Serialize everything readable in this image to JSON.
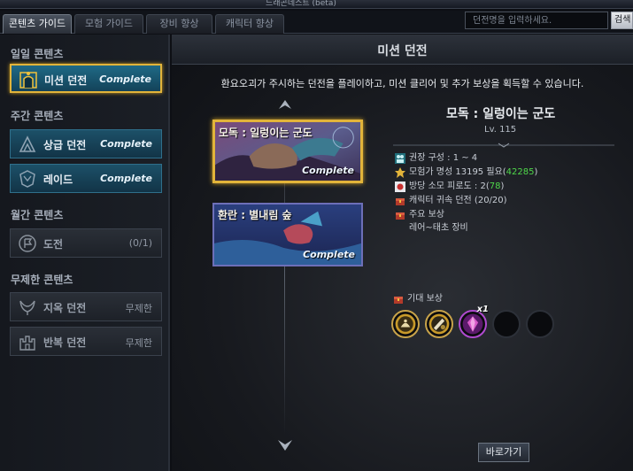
{
  "window": {
    "title": "드래곤네스트 (beta)"
  },
  "tabs": [
    {
      "label": "콘텐츠 가이드",
      "active": true
    },
    {
      "label": "모험 가이드"
    },
    {
      "label": "장비 향상"
    },
    {
      "label": "캐릭터 향상"
    }
  ],
  "search": {
    "placeholder": "던전명을 입력하세요.",
    "button_label": "검색"
  },
  "sidebar": {
    "daily": {
      "heading": "일일 콘텐츠",
      "items": [
        {
          "label": "미션 던전",
          "status": "Complete",
          "icon": "gate-icon"
        }
      ]
    },
    "weekly": {
      "heading": "주간 콘텐츠",
      "items": [
        {
          "label": "상급 던전",
          "status": "Complete",
          "icon": "peak-icon"
        },
        {
          "label": "레이드",
          "status": "Complete",
          "icon": "crest-icon"
        }
      ]
    },
    "monthly": {
      "heading": "월간 콘텐츠",
      "items": [
        {
          "label": "도전",
          "status": "(0/1)",
          "icon": "flag-icon"
        }
      ]
    },
    "unlimited": {
      "heading": "무제한 콘텐츠",
      "items": [
        {
          "label": "지옥 던전",
          "status": "무제한",
          "icon": "horns-icon"
        },
        {
          "label": "반복 던전",
          "status": "무제한",
          "icon": "castle-icon"
        }
      ]
    }
  },
  "main": {
    "title": "미션 던전",
    "description": "환요오괴가 주시하는 던전을 플레이하고, 미션 클리어 및 추가 보상을 획득할 수 있습니다.",
    "dungeons": [
      {
        "name": "모독 : 일렁이는 군도",
        "status": "Complete",
        "selected": true
      },
      {
        "name": "환란 : 별내림 숲",
        "status": "Complete",
        "selected": false
      }
    ],
    "detail": {
      "title": "모독 : 일렁이는 군도",
      "level": "Lv. 115",
      "party_label": "권장 구성 : 1 ~ 4",
      "fame_prefix": "모험가 명성 13195 필요(",
      "fame_value": "42285",
      "fame_suffix": ")",
      "fatigue_prefix": "방당 소모 피로도 : 2(",
      "fatigue_value": "78",
      "fatigue_suffix": ")",
      "char_bound": "캐릭터 귀속 던전 (20/20)",
      "main_reward_label": "주요 보상",
      "main_reward_value": "레어~태초 장비",
      "expected_reward_label": "기대 보상",
      "reward_slots": [
        {
          "icon": "gold-bag-icon",
          "filled": true
        },
        {
          "icon": "scroll-coin-icon",
          "filled": true
        },
        {
          "icon": "purple-crystal-icon",
          "filled": true,
          "count": "x1"
        },
        {
          "icon": "empty-slot",
          "filled": false
        },
        {
          "icon": "empty-slot",
          "filled": false
        }
      ]
    },
    "go_button": "바로가기"
  }
}
